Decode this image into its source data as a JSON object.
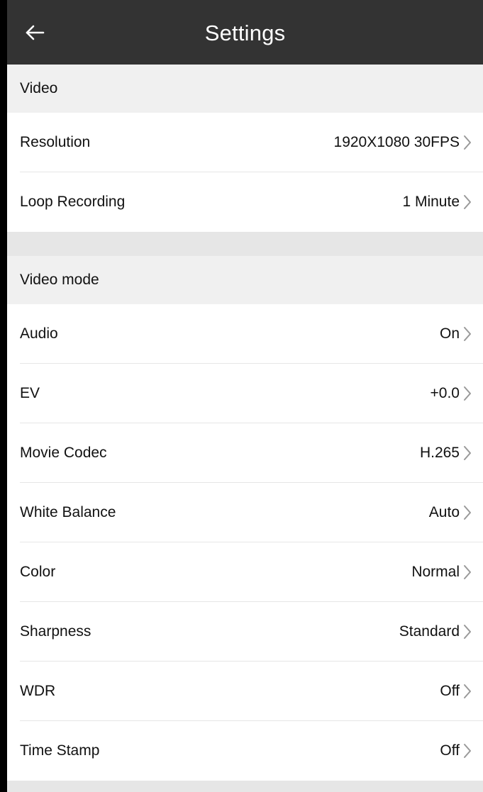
{
  "header": {
    "title": "Settings",
    "back_icon": "back-arrow-icon"
  },
  "sections": [
    {
      "title": "Video",
      "items": [
        {
          "label": "Resolution",
          "value": "1920X1080 30FPS"
        },
        {
          "label": "Loop Recording",
          "value": "1 Minute"
        }
      ]
    },
    {
      "title": "Video mode",
      "items": [
        {
          "label": "Audio",
          "value": "On"
        },
        {
          "label": "EV",
          "value": "+0.0"
        },
        {
          "label": "Movie Codec",
          "value": "H.265"
        },
        {
          "label": "White Balance",
          "value": "Auto"
        },
        {
          "label": "Color",
          "value": "Normal"
        },
        {
          "label": "Sharpness",
          "value": "Standard"
        },
        {
          "label": "WDR",
          "value": "Off"
        },
        {
          "label": "Time Stamp",
          "value": "Off"
        }
      ]
    }
  ],
  "icons": {
    "row_chevron": "chevron-right-icon"
  },
  "colors": {
    "header_bg": "#333333",
    "section_bg": "#f0f0f0",
    "divider": "#e6e6e6",
    "text": "#111111",
    "chevron": "#999999"
  }
}
